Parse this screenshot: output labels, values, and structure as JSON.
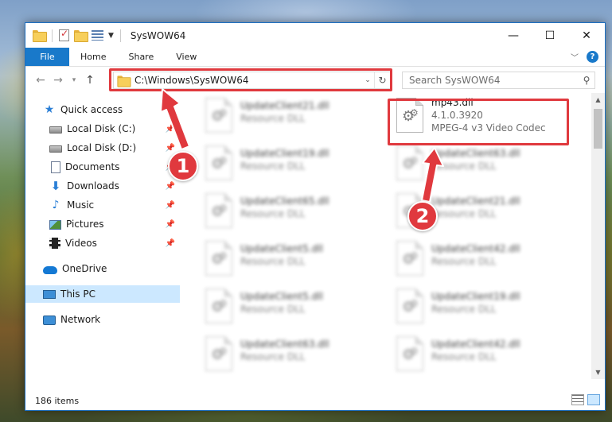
{
  "window": {
    "title": "SysWOW64",
    "controls": {
      "minimize": "—",
      "maximize": "☐",
      "close": "✕"
    }
  },
  "ribbon": {
    "tabs": [
      "File",
      "Home",
      "Share",
      "View"
    ],
    "help": "?"
  },
  "navigation": {
    "address": "C:\\Windows\\SysWOW64",
    "search_placeholder": "Search SysWOW64"
  },
  "sidebar": {
    "items": [
      {
        "label": "Quick access",
        "icon": "star-icon"
      },
      {
        "label": "Local Disk (C:)",
        "icon": "disk-icon",
        "pinned": true
      },
      {
        "label": "Local Disk (D:)",
        "icon": "disk-icon",
        "pinned": true
      },
      {
        "label": "Documents",
        "icon": "document-icon",
        "pinned": true
      },
      {
        "label": "Downloads",
        "icon": "download-icon",
        "pinned": true
      },
      {
        "label": "Music",
        "icon": "music-icon",
        "pinned": true
      },
      {
        "label": "Pictures",
        "icon": "pictures-icon",
        "pinned": true
      },
      {
        "label": "Videos",
        "icon": "videos-icon",
        "pinned": true
      },
      {
        "label": "OneDrive",
        "icon": "cloud-icon"
      },
      {
        "label": "This PC",
        "icon": "computer-icon",
        "selected": true
      },
      {
        "label": "Network",
        "icon": "network-icon"
      }
    ]
  },
  "files": [
    {
      "name": "UpdateClient21.dll",
      "desc": "Resource DLL"
    },
    {
      "name": "mp43.dll",
      "version": "4.1.0.3920",
      "desc": "MPEG-4 v3 Video Codec"
    },
    {
      "name": "UpdateClient19.dll",
      "desc": "Resource DLL"
    },
    {
      "name": "UpdateClient63.dll",
      "desc": "Resource DLL"
    },
    {
      "name": "UpdateClient65.dll",
      "desc": "Resource DLL"
    },
    {
      "name": "UpdateClient21.dll",
      "desc": "Resource DLL"
    },
    {
      "name": "UpdateClient5.dll",
      "desc": "Resource DLL"
    },
    {
      "name": "UpdateClient42.dll",
      "desc": "Resource DLL"
    },
    {
      "name": "UpdateClient5.dll",
      "desc": "Resource DLL"
    },
    {
      "name": "UpdateClient19.dll",
      "desc": "Resource DLL"
    },
    {
      "name": "UpdateClient63.dll",
      "desc": "Resource DLL"
    },
    {
      "name": "UpdateClient42.dll",
      "desc": "Resource DLL"
    }
  ],
  "status": {
    "item_count": "186 items"
  },
  "annotations": {
    "step1": "1",
    "step2": "2",
    "color": "#e0393e"
  }
}
